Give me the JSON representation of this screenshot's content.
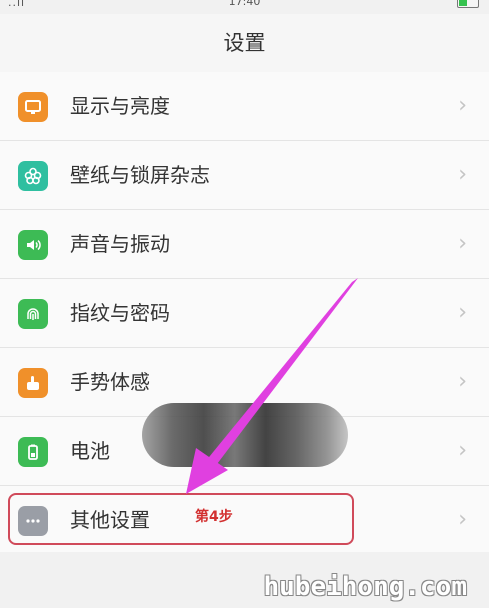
{
  "status_bar": {
    "time": "17:40",
    "signal": "..ıl"
  },
  "header": {
    "title": "设置"
  },
  "settings": {
    "items": [
      {
        "label": "显示与亮度",
        "icon": "display-icon",
        "color": "#f0902a"
      },
      {
        "label": "壁纸与锁屏杂志",
        "icon": "flower-icon",
        "color": "#2fbfa0"
      },
      {
        "label": "声音与振动",
        "icon": "speaker-icon",
        "color": "#3dbb55"
      },
      {
        "label": "指纹与密码",
        "icon": "fingerprint-icon",
        "color": "#3dbb55"
      },
      {
        "label": "手势体感",
        "icon": "hand-icon",
        "color": "#f0902a"
      },
      {
        "label": "电池",
        "icon": "battery-icon",
        "color": "#3dbb55"
      },
      {
        "label": "其他设置",
        "icon": "more-icon",
        "color": "#9a9ea6"
      }
    ],
    "chevron": "›"
  },
  "annotation": {
    "step_label": "第4步",
    "arrow_color": "#e040e0",
    "box_color": "#d04a5a"
  },
  "watermark": {
    "text": "hubeihong.com"
  }
}
